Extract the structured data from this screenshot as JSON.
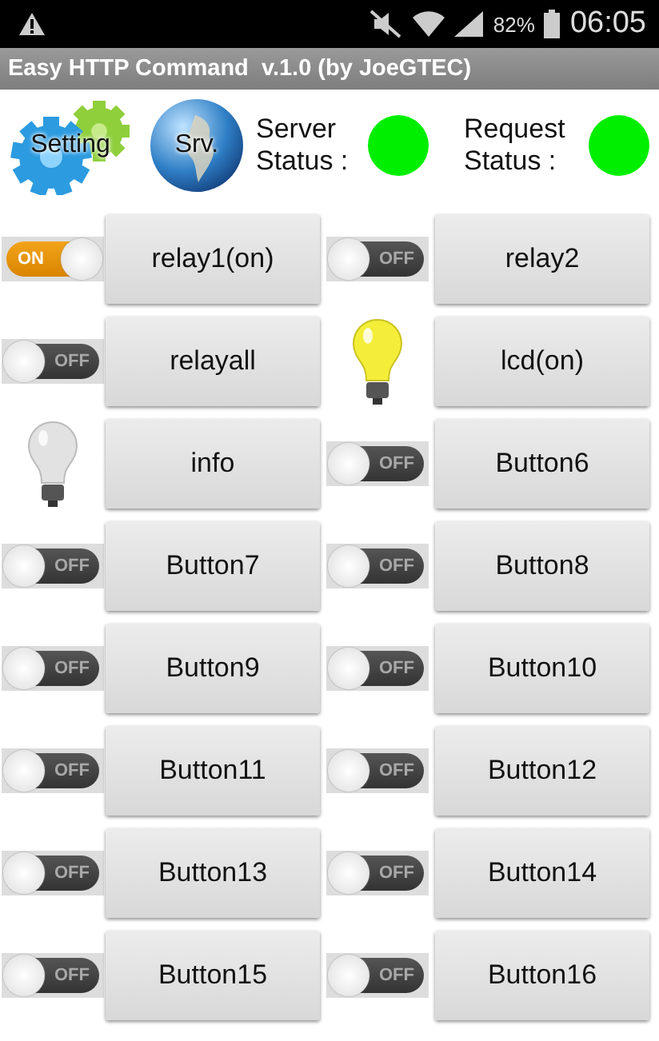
{
  "status_bar": {
    "battery": "82%",
    "time": "06:05"
  },
  "title": "Easy HTTP Command  v.1.0 (by JoeGTEC)",
  "header": {
    "setting_button": "Setting",
    "server_button": "Srv.",
    "server_status": {
      "label": "Server Status :",
      "color": "#00ee00"
    },
    "request_status": {
      "label": "Request Status :",
      "color": "#00ee00"
    }
  },
  "cells": [
    {
      "indicator": {
        "kind": "switch",
        "on": true,
        "label": "ON"
      },
      "button": "relay1(on)"
    },
    {
      "indicator": {
        "kind": "switch",
        "on": false,
        "label": "OFF"
      },
      "button": "relay2"
    },
    {
      "indicator": {
        "kind": "switch",
        "on": false,
        "label": "OFF"
      },
      "button": "relayall"
    },
    {
      "indicator": {
        "kind": "bulb",
        "on": true
      },
      "button": "lcd(on)"
    },
    {
      "indicator": {
        "kind": "bulb",
        "on": false
      },
      "button": "info"
    },
    {
      "indicator": {
        "kind": "switch",
        "on": false,
        "label": "OFF"
      },
      "button": "Button6"
    },
    {
      "indicator": {
        "kind": "switch",
        "on": false,
        "label": "OFF"
      },
      "button": "Button7"
    },
    {
      "indicator": {
        "kind": "switch",
        "on": false,
        "label": "OFF"
      },
      "button": "Button8"
    },
    {
      "indicator": {
        "kind": "switch",
        "on": false,
        "label": "OFF"
      },
      "button": "Button9"
    },
    {
      "indicator": {
        "kind": "switch",
        "on": false,
        "label": "OFF"
      },
      "button": "Button10"
    },
    {
      "indicator": {
        "kind": "switch",
        "on": false,
        "label": "OFF"
      },
      "button": "Button11"
    },
    {
      "indicator": {
        "kind": "switch",
        "on": false,
        "label": "OFF"
      },
      "button": "Button12"
    },
    {
      "indicator": {
        "kind": "switch",
        "on": false,
        "label": "OFF"
      },
      "button": "Button13"
    },
    {
      "indicator": {
        "kind": "switch",
        "on": false,
        "label": "OFF"
      },
      "button": "Button14"
    },
    {
      "indicator": {
        "kind": "switch",
        "on": false,
        "label": "OFF"
      },
      "button": "Button15"
    },
    {
      "indicator": {
        "kind": "switch",
        "on": false,
        "label": "OFF"
      },
      "button": "Button16"
    }
  ]
}
